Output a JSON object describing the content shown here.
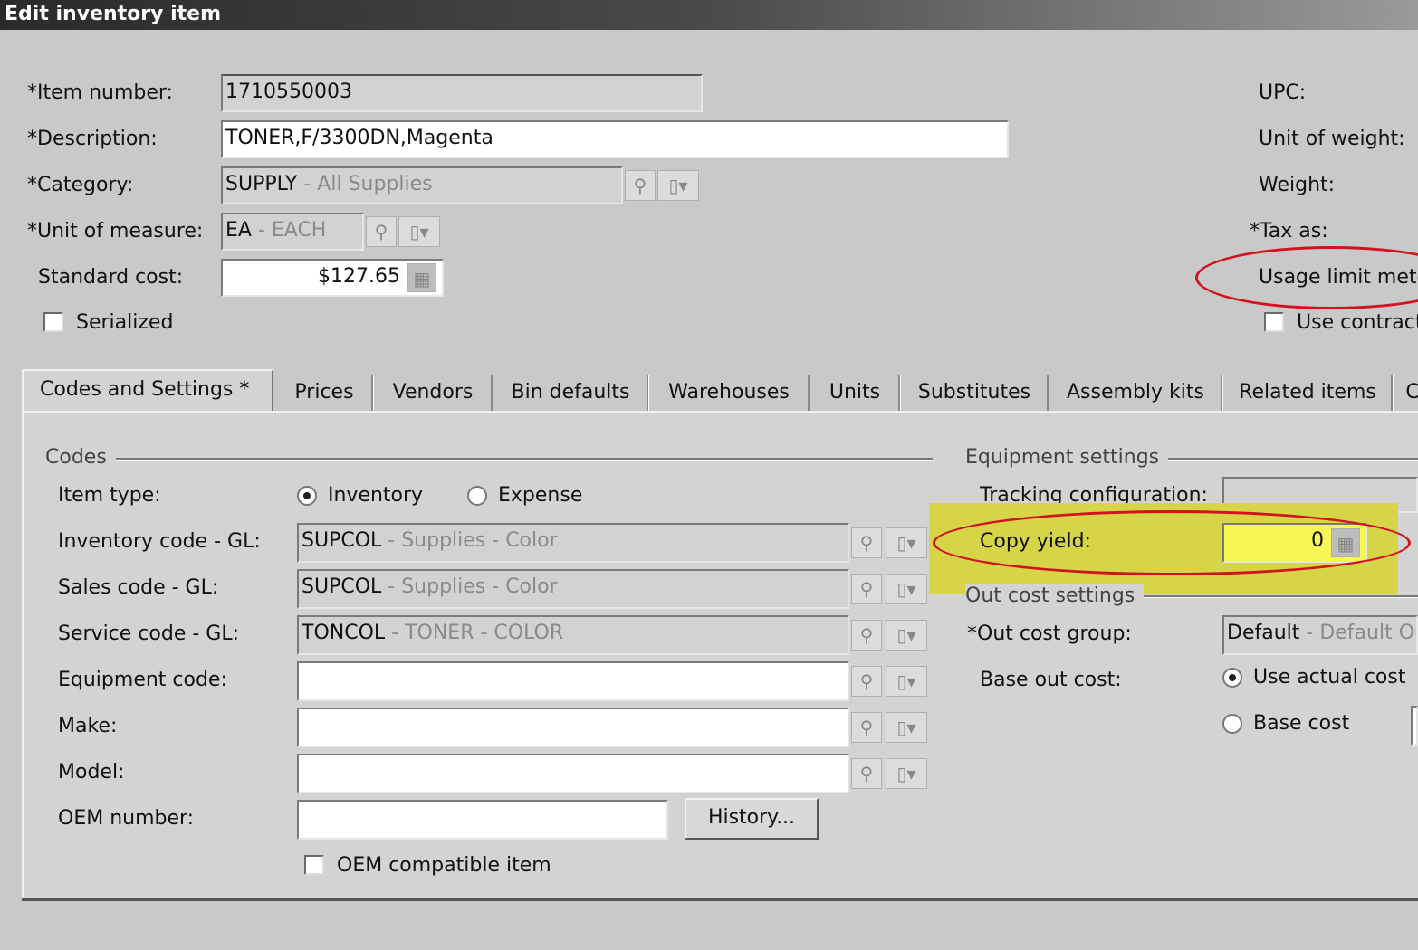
{
  "window": {
    "title": "Edit inventory item"
  },
  "header": {
    "item_number_label": "*Item number:",
    "item_number_value": "1710550003",
    "description_label": "*Description:",
    "description_value": "TONER,F/3300DN,Magenta",
    "category_label": "*Category:",
    "category_code": "SUPPLY",
    "category_desc": " - All Supplies",
    "uom_label": "*Unit of measure:",
    "uom_code": "EA",
    "uom_desc": " - EACH",
    "standard_cost_label": "Standard cost:",
    "standard_cost_value": "$127.65",
    "serialized_label": "Serialized",
    "upc_label": "UPC:",
    "unit_of_weight_label": "Unit of weight:",
    "weight_label": "Weight:",
    "tax_as_label": "*Tax as:",
    "usage_limit_label": "Usage limit mete",
    "use_contract_label": "Use contract"
  },
  "tabs": [
    {
      "label": "Codes and Settings  *"
    },
    {
      "label": "Prices"
    },
    {
      "label": "Vendors"
    },
    {
      "label": "Bin defaults"
    },
    {
      "label": "Warehouses"
    },
    {
      "label": "Units"
    },
    {
      "label": "Substitutes"
    },
    {
      "label": "Assembly kits"
    },
    {
      "label": "Related items"
    },
    {
      "label": "C"
    }
  ],
  "codes": {
    "group_label": "Codes",
    "item_type_label": "Item type:",
    "radio_inventory": "Inventory",
    "radio_expense": "Expense",
    "inventory_code_label": "Inventory code - GL:",
    "inventory_code": "SUPCOL",
    "inventory_desc": " - Supplies - Color",
    "sales_code_label": "Sales code - GL:",
    "sales_code": "SUPCOL",
    "sales_desc": " - Supplies - Color",
    "service_code_label": "Service code - GL:",
    "service_code": "TONCOL",
    "service_desc": " - TONER - COLOR",
    "equipment_code_label": "Equipment code:",
    "make_label": "Make:",
    "model_label": "Model:",
    "oem_number_label": "OEM number:",
    "history_button": "History...",
    "oem_compatible_label": "OEM compatible item"
  },
  "equipment": {
    "group_label": "Equipment settings",
    "tracking_label": "Tracking configuration:",
    "copy_yield_label": "Copy yield:",
    "copy_yield_value": "0"
  },
  "outcost": {
    "group_label": "Out cost settings",
    "group_field_label": "*Out cost group:",
    "group_code": "Default",
    "group_desc": " - Default Ou",
    "base_label": "Base out cost:",
    "radio_actual": "Use actual cost",
    "radio_base": "Base cost"
  },
  "icons": {
    "lookup": "magnifier-icon",
    "dropdown": "dropdown-menu-icon",
    "calculator": "calculator-icon"
  },
  "colors": {
    "highlight": "#d6d548",
    "annotation": "#d0131f"
  }
}
